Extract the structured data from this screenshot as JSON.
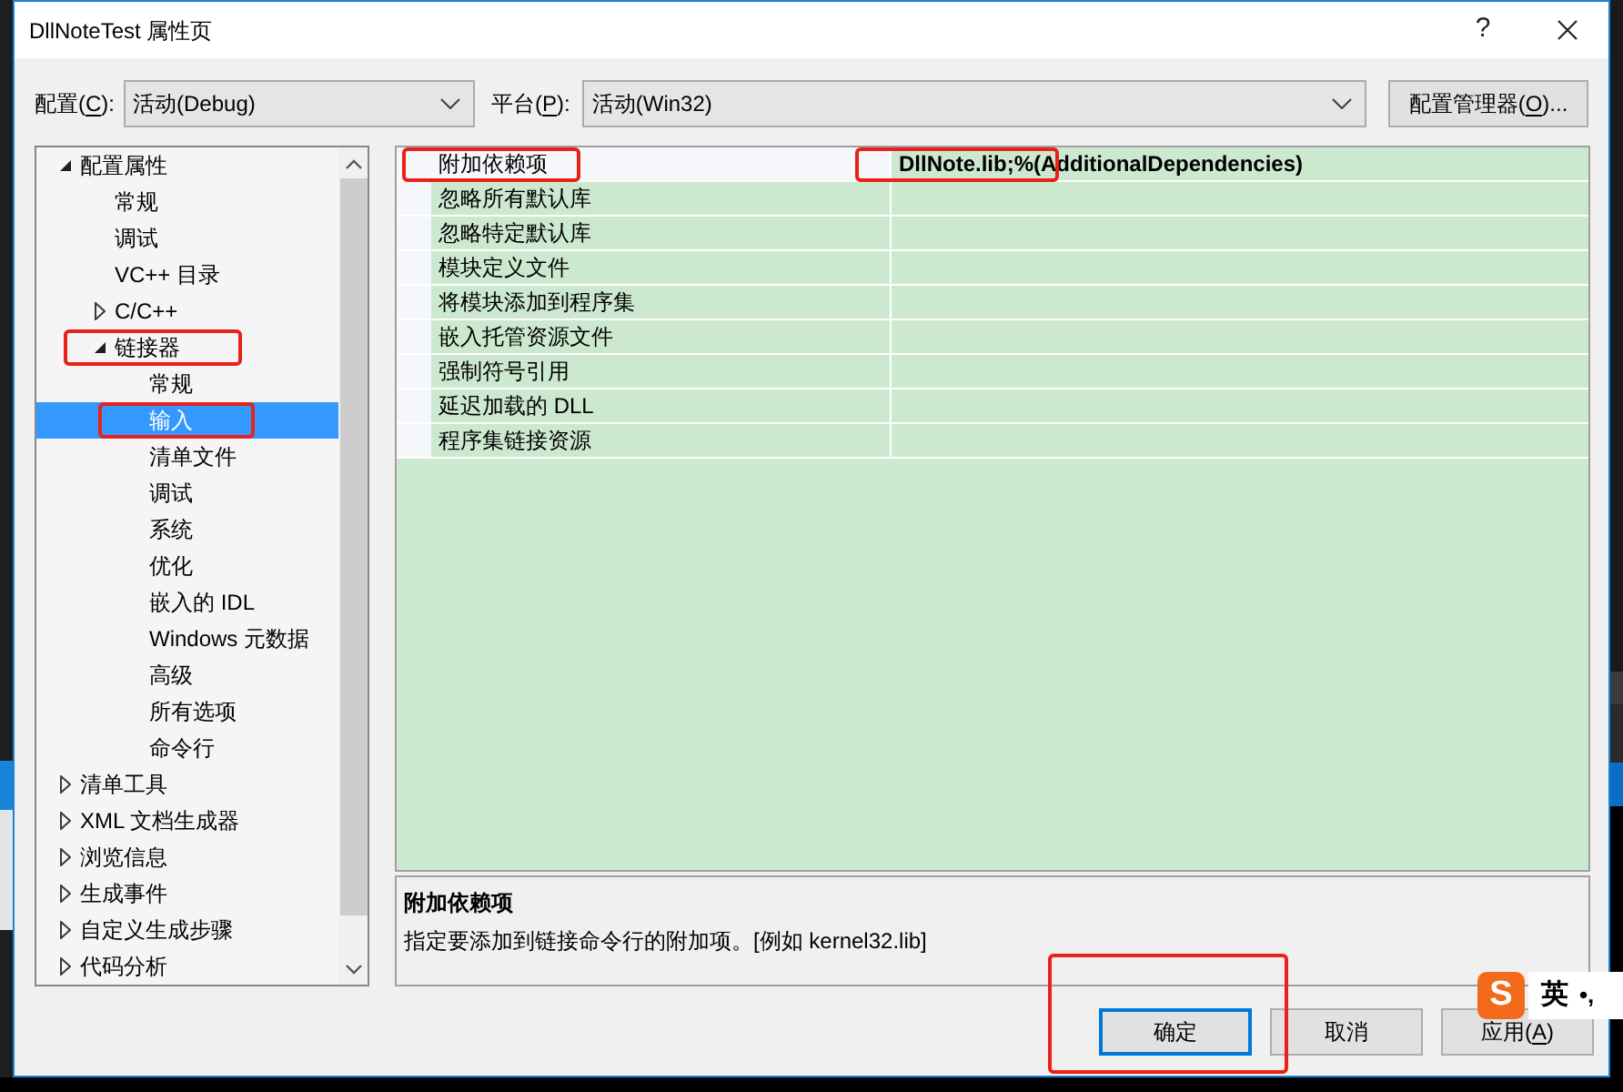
{
  "window": {
    "title": "DllNoteTest 属性页",
    "help_button": "?"
  },
  "config_bar": {
    "configuration": {
      "label": {
        "before": "配置(",
        "key": "C",
        "after": "):"
      },
      "value": "活动(Debug)"
    },
    "platform": {
      "label": {
        "before": "平台(",
        "key": "P",
        "after": "):"
      },
      "value": "活动(Win32)"
    },
    "manager_button": {
      "label": {
        "before": "配置管理器(",
        "key": "O",
        "after": ")..."
      }
    }
  },
  "tree": {
    "items": [
      {
        "label": "配置属性",
        "kind": "folder",
        "expanded": true,
        "selected": false,
        "highlighted": false,
        "children": [
          {
            "label": "常规",
            "kind": "leaf",
            "selected": false,
            "highlighted": false
          },
          {
            "label": "调试",
            "kind": "leaf",
            "selected": false,
            "highlighted": false
          },
          {
            "label": "VC++ 目录",
            "kind": "leaf",
            "selected": false,
            "highlighted": false
          },
          {
            "label": "C/C++",
            "kind": "folder",
            "expanded": false,
            "selected": false,
            "highlighted": false
          },
          {
            "label": "链接器",
            "kind": "folder",
            "expanded": true,
            "selected": false,
            "highlighted": true,
            "children": [
              {
                "label": "常规",
                "kind": "leaf",
                "selected": false,
                "highlighted": false
              },
              {
                "label": "输入",
                "kind": "leaf",
                "selected": true,
                "highlighted": true
              },
              {
                "label": "清单文件",
                "kind": "leaf",
                "selected": false,
                "highlighted": false
              },
              {
                "label": "调试",
                "kind": "leaf",
                "selected": false,
                "highlighted": false
              },
              {
                "label": "系统",
                "kind": "leaf",
                "selected": false,
                "highlighted": false
              },
              {
                "label": "优化",
                "kind": "leaf",
                "selected": false,
                "highlighted": false
              },
              {
                "label": "嵌入的 IDL",
                "kind": "leaf",
                "selected": false,
                "highlighted": false
              },
              {
                "label": "Windows 元数据",
                "kind": "leaf",
                "selected": false,
                "highlighted": false
              },
              {
                "label": "高级",
                "kind": "leaf",
                "selected": false,
                "highlighted": false
              },
              {
                "label": "所有选项",
                "kind": "leaf",
                "selected": false,
                "highlighted": false
              },
              {
                "label": "命令行",
                "kind": "leaf",
                "selected": false,
                "highlighted": false
              }
            ]
          }
        ]
      },
      {
        "label": "清单工具",
        "kind": "folder",
        "expanded": false,
        "selected": false,
        "highlighted": false
      },
      {
        "label": "XML 文档生成器",
        "kind": "folder",
        "expanded": false,
        "selected": false,
        "highlighted": false
      },
      {
        "label": "浏览信息",
        "kind": "folder",
        "expanded": false,
        "selected": false,
        "highlighted": false
      },
      {
        "label": "生成事件",
        "kind": "folder",
        "expanded": false,
        "selected": false,
        "highlighted": false
      },
      {
        "label": "自定义生成步骤",
        "kind": "folder",
        "expanded": false,
        "selected": false,
        "highlighted": false
      },
      {
        "label": "代码分析",
        "kind": "folder",
        "expanded": false,
        "selected": false,
        "highlighted": false
      }
    ]
  },
  "property_grid": {
    "rows": [
      {
        "name": "附加依赖项",
        "value": "DllNote.lib;%(AdditionalDependencies)",
        "selected": true,
        "modified": true,
        "name_highlighted": true,
        "value_highlighted": true
      },
      {
        "name": "忽略所有默认库",
        "selected": false,
        "name_highlighted": false,
        "value_highlighted": false
      },
      {
        "name": "忽略特定默认库",
        "selected": false,
        "name_highlighted": false,
        "value_highlighted": false
      },
      {
        "name": "模块定义文件",
        "selected": false,
        "name_highlighted": false,
        "value_highlighted": false
      },
      {
        "name": "将模块添加到程序集",
        "selected": false,
        "name_highlighted": false,
        "value_highlighted": false
      },
      {
        "name": "嵌入托管资源文件",
        "selected": false,
        "name_highlighted": false,
        "value_highlighted": false
      },
      {
        "name": "强制符号引用",
        "selected": false,
        "name_highlighted": false,
        "value_highlighted": false
      },
      {
        "name": "延迟加载的 DLL",
        "selected": false,
        "name_highlighted": false,
        "value_highlighted": false
      },
      {
        "name": "程序集链接资源",
        "selected": false,
        "name_highlighted": false,
        "value_highlighted": false
      }
    ]
  },
  "description": {
    "title": "附加依赖项",
    "text": "指定要添加到链接命令行的附加项。[例如 kernel32.lib]"
  },
  "buttons": [
    {
      "label": "确定",
      "default": true,
      "highlighted": true
    },
    {
      "label": "取消",
      "default": false,
      "highlighted": false
    },
    {
      "label": {
        "before": "应用(",
        "key": "A",
        "after": ")"
      },
      "default": false,
      "highlighted": false
    }
  ],
  "ime_toolbar": {
    "logo": "S",
    "mode": "英",
    "punctuation": "•,"
  }
}
